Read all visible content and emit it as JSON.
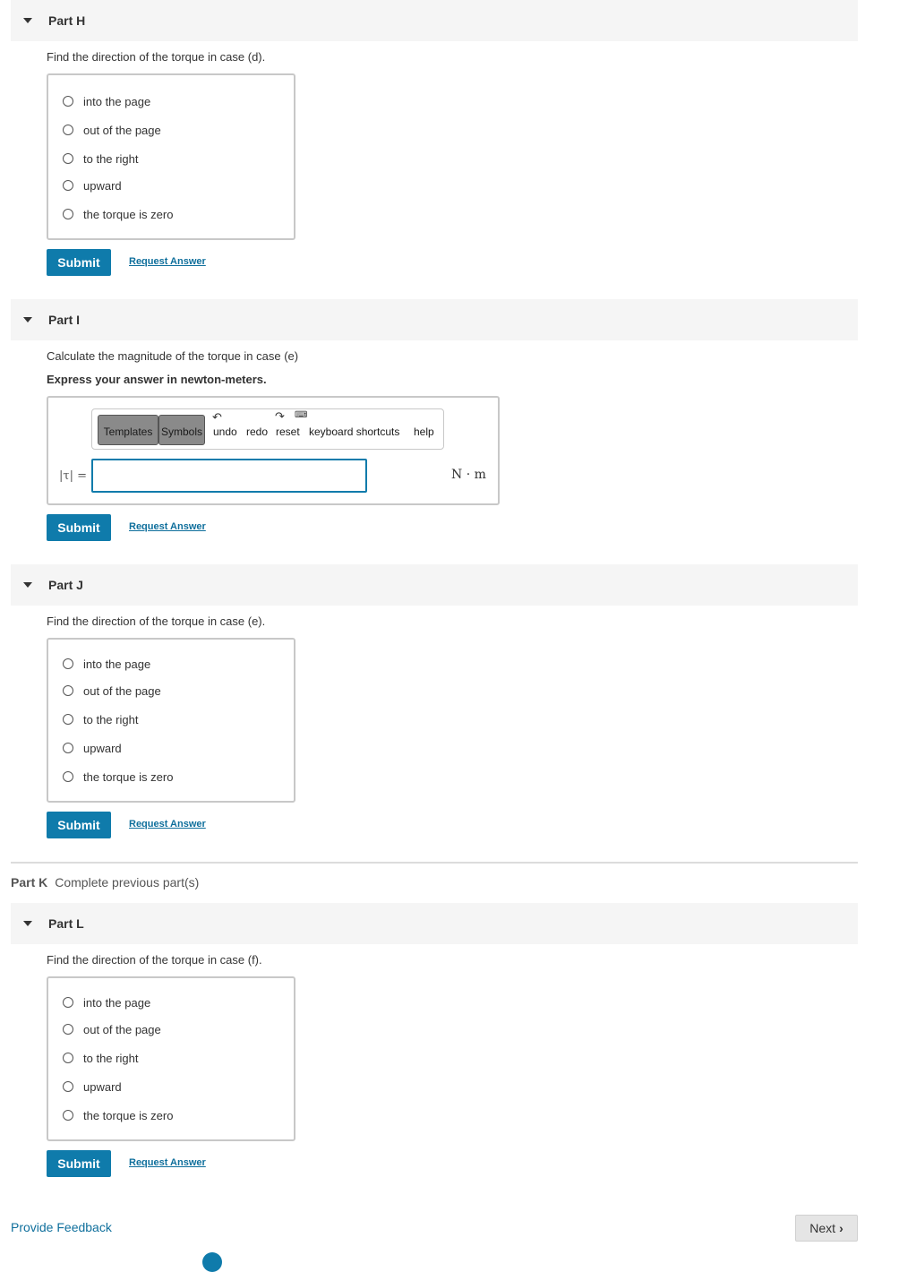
{
  "parts": {
    "h": {
      "title": "Part H",
      "prompt": "Find the direction of the torque in case (d).",
      "choices": [
        "into the page",
        "out of the page",
        "to the right",
        "upward",
        "the torque is zero"
      ],
      "submit": "Submit",
      "request": "Request Answer"
    },
    "i": {
      "title": "Part I",
      "prompt": "Calculate the magnitude of the torque in case (e)",
      "instruction": "Express your answer in newton-meters.",
      "toolbar": {
        "templates": "Templates",
        "symbols": "Symbols",
        "undo": "undo",
        "redo": "redo",
        "reset": "reset",
        "shortcuts": "keyboard shortcuts",
        "help": "help"
      },
      "label": "|τ| =",
      "input_value": "",
      "units": "N · m",
      "submit": "Submit",
      "request": "Request Answer"
    },
    "j": {
      "title": "Part J",
      "prompt": "Find the direction of the torque in case (e).",
      "choices": [
        "into the page",
        "out of the page",
        "to the right",
        "upward",
        "the torque is zero"
      ],
      "submit": "Submit",
      "request": "Request Answer"
    },
    "k": {
      "title": "Part K",
      "status": "Complete previous part(s)"
    },
    "l": {
      "title": "Part L",
      "prompt": "Find the direction of the torque in case (f).",
      "choices": [
        "into the page",
        "out of the page",
        "to the right",
        "upward",
        "the torque is zero"
      ],
      "submit": "Submit",
      "request": "Request Answer"
    }
  },
  "footer": {
    "feedback": "Provide Feedback",
    "next": "Next"
  },
  "colors": {
    "accent": "#0f7bab",
    "link": "#0f6f9c",
    "header_bg": "#f5f5f5"
  }
}
